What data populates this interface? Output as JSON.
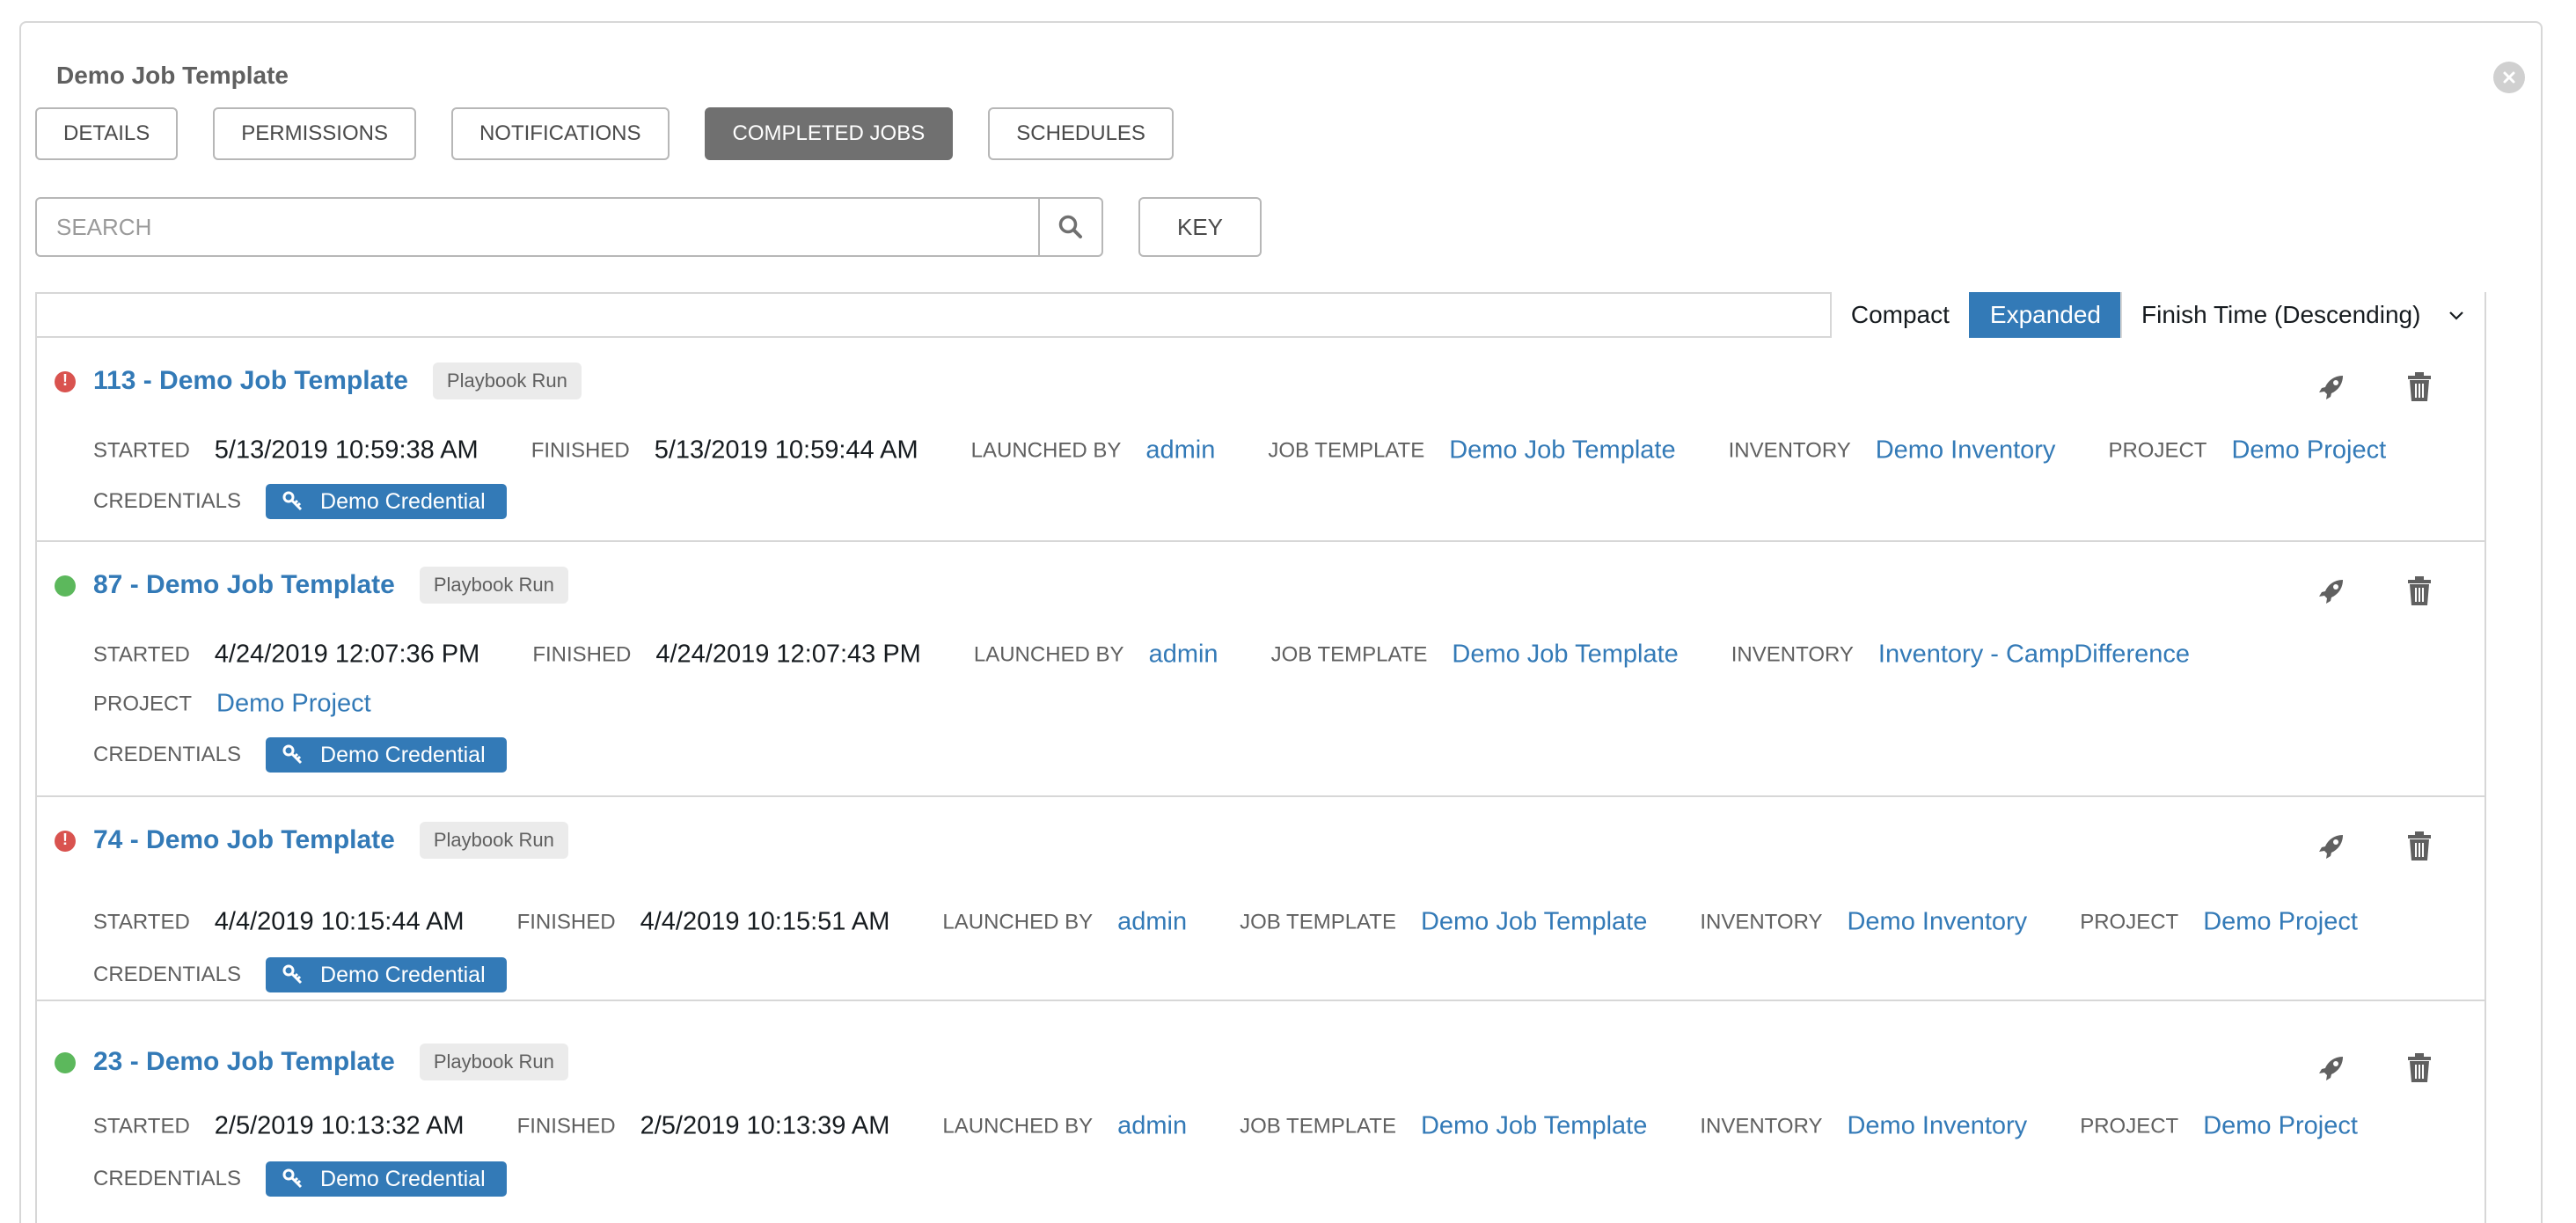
{
  "panel": {
    "title": "Demo Job Template"
  },
  "tabs": [
    {
      "label": "DETAILS",
      "active": false
    },
    {
      "label": "PERMISSIONS",
      "active": false
    },
    {
      "label": "NOTIFICATIONS",
      "active": false
    },
    {
      "label": "COMPLETED JOBS",
      "active": true
    },
    {
      "label": "SCHEDULES",
      "active": false
    }
  ],
  "search": {
    "placeholder": "SEARCH",
    "value": "",
    "key_label": "KEY"
  },
  "toolbar": {
    "compact_label": "Compact",
    "expanded_label": "Expanded",
    "sort_label": "Finish Time (Descending)",
    "active_view": "Expanded"
  },
  "labels": {
    "started": "STARTED",
    "finished": "FINISHED",
    "launched_by": "LAUNCHED BY",
    "job_template": "JOB TEMPLATE",
    "inventory": "INVENTORY",
    "project": "PROJECT",
    "credentials": "CREDENTIALS"
  },
  "colors": {
    "accent": "#337ab7",
    "failed": "#d9534f",
    "success": "#5cb85c",
    "active_tab": "#707070"
  },
  "jobs": [
    {
      "title": "113 - Demo Job Template",
      "type": "Playbook Run",
      "status": "failed",
      "started": "5/13/2019 10:59:38 AM",
      "finished": "5/13/2019 10:59:44 AM",
      "launched_by": "admin",
      "job_template": "Demo Job Template",
      "inventory": "Demo Inventory",
      "project": "Demo Project",
      "credential": "Demo Credential"
    },
    {
      "title": "87 - Demo Job Template",
      "type": "Playbook Run",
      "status": "successful",
      "started": "4/24/2019 12:07:36 PM",
      "finished": "4/24/2019 12:07:43 PM",
      "launched_by": "admin",
      "job_template": "Demo Job Template",
      "inventory": "Inventory - CampDifference",
      "project": "Demo Project",
      "credential": "Demo Credential"
    },
    {
      "title": "74 - Demo Job Template",
      "type": "Playbook Run",
      "status": "failed",
      "started": "4/4/2019 10:15:44 AM",
      "finished": "4/4/2019 10:15:51 AM",
      "launched_by": "admin",
      "job_template": "Demo Job Template",
      "inventory": "Demo Inventory",
      "project": "Demo Project",
      "credential": "Demo Credential"
    },
    {
      "title": "23 - Demo Job Template",
      "type": "Playbook Run",
      "status": "successful",
      "started": "2/5/2019 10:13:32 AM",
      "finished": "2/5/2019 10:13:39 AM",
      "launched_by": "admin",
      "job_template": "Demo Job Template",
      "inventory": "Demo Inventory",
      "project": "Demo Project",
      "credential": "Demo Credential"
    }
  ]
}
